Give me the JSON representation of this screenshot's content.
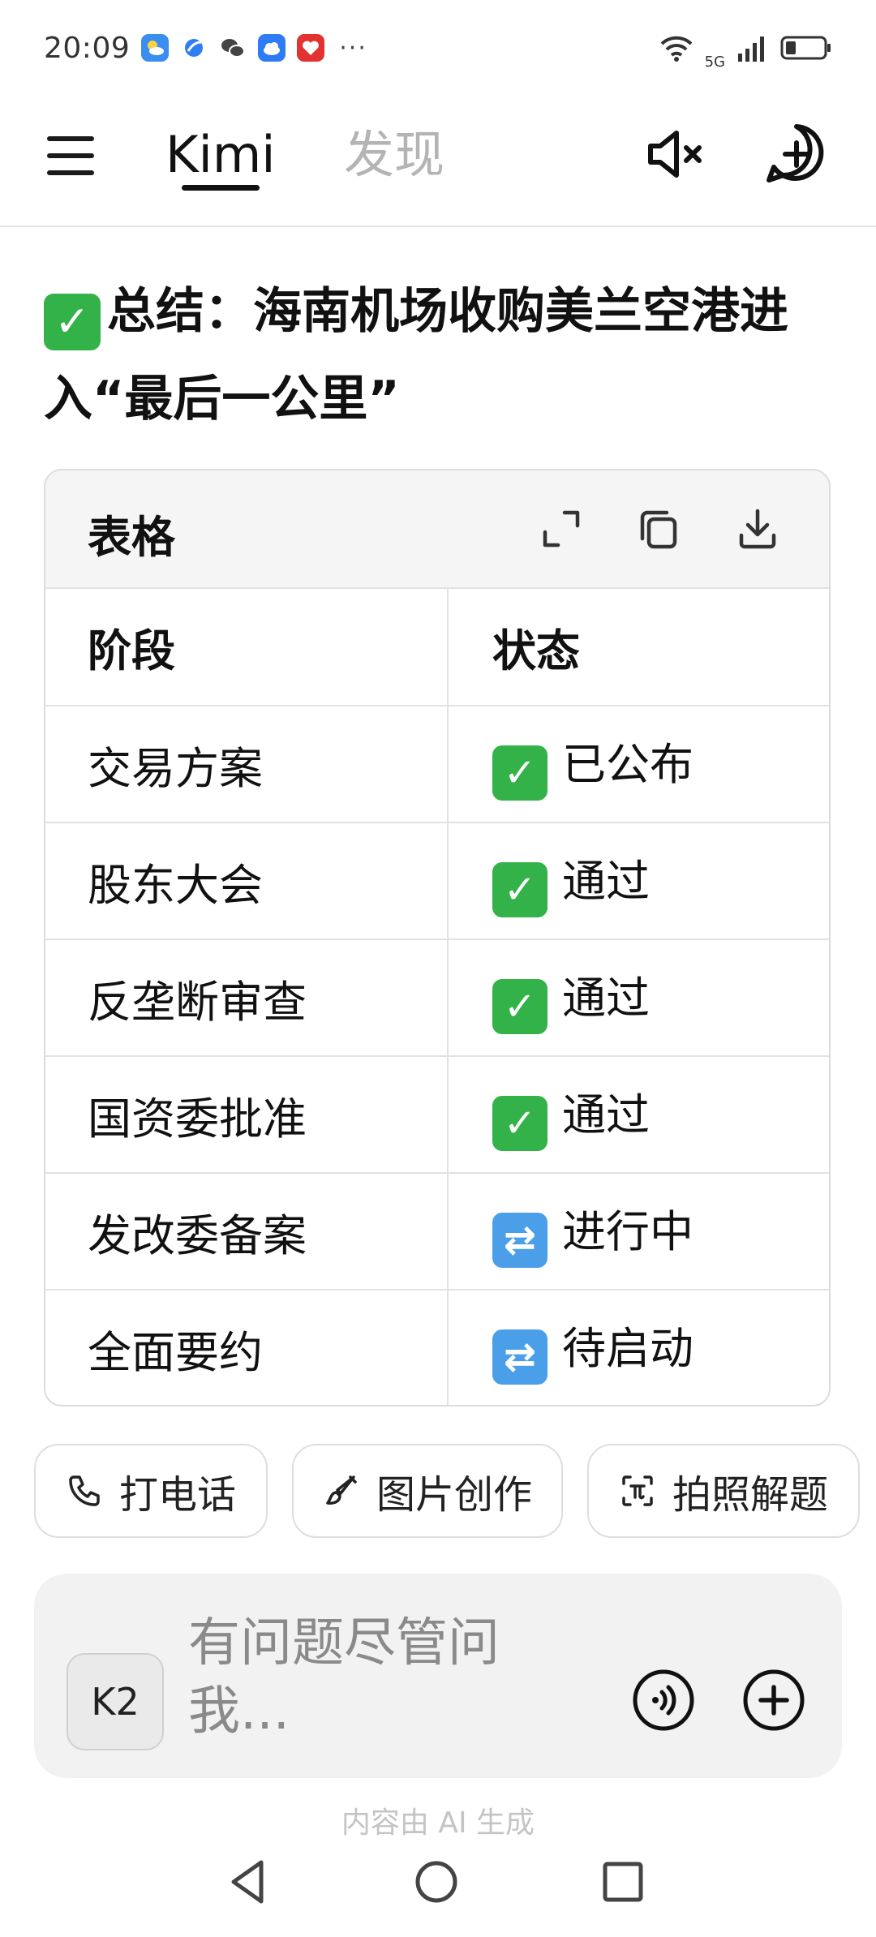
{
  "status_bar": {
    "time": "20:09",
    "more": "···",
    "network": "5G",
    "app_icons": [
      "weather-icon",
      "browser-icon",
      "wechat-icon",
      "cloud-icon",
      "health-icon"
    ]
  },
  "header": {
    "tabs": [
      {
        "label": "Kimi",
        "active": true
      },
      {
        "label": "发现",
        "active": false
      }
    ]
  },
  "summary": {
    "text": "总结：海南机场收购美兰空港进入“最后一公里”"
  },
  "table_card": {
    "title": "表格",
    "columns": [
      "阶段",
      "状态"
    ],
    "rows": [
      {
        "stage": "交易方案",
        "status": "已公布",
        "icon": "check-mark-icon"
      },
      {
        "stage": "股东大会",
        "status": "通过",
        "icon": "check-mark-icon"
      },
      {
        "stage": "反垄断审查",
        "status": "通过",
        "icon": "check-mark-icon"
      },
      {
        "stage": "国资委批准",
        "status": "通过",
        "icon": "check-mark-icon"
      },
      {
        "stage": "发改委备案",
        "status": "进行中",
        "icon": "refresh-arrows-icon"
      },
      {
        "stage": "全面要约",
        "status": "待启动",
        "icon": "refresh-arrows-icon"
      }
    ]
  },
  "chips": [
    {
      "label": "打电话",
      "icon": "phone-icon"
    },
    {
      "label": "图片创作",
      "icon": "brush-icon"
    },
    {
      "label": "拍照解题",
      "icon": "scan-icon"
    }
  ],
  "input": {
    "model_badge": "K2",
    "placeholder": "有问题尽管问我..."
  },
  "footer_note": "内容由 AI 生成",
  "colors": {
    "check_green": "#33b249",
    "progress_blue": "#4a9fe8",
    "inactive_tab": "#b4b4b4"
  }
}
